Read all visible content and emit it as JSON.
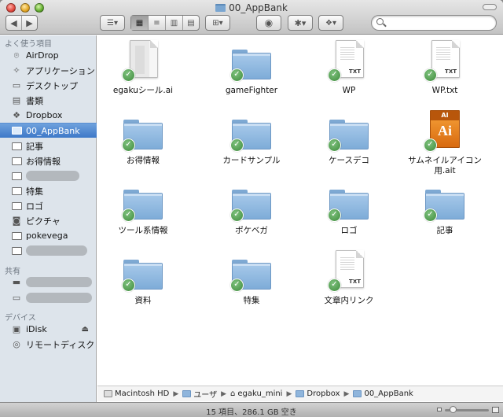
{
  "window": {
    "title": "00_AppBank",
    "search": {
      "placeholder": "",
      "value": ""
    }
  },
  "toolbar": {
    "back_icon": "chevron-left-icon",
    "forward_icon": "chevron-right-icon",
    "view_modes": [
      "icon",
      "list",
      "column",
      "coverflow"
    ],
    "active_view": "icon"
  },
  "sidebar": {
    "favorites_heading": "よく使う項目",
    "favorites": [
      {
        "label": "AirDrop",
        "icon": "airdrop-icon"
      },
      {
        "label": "アプリケーション",
        "icon": "applications-icon"
      },
      {
        "label": "デスクトップ",
        "icon": "desktop-icon"
      },
      {
        "label": "書類",
        "icon": "documents-icon"
      },
      {
        "label": "Dropbox",
        "icon": "dropbox-icon"
      },
      {
        "label": "00_AppBank",
        "icon": "folder-icon",
        "selected": true
      },
      {
        "label": "記事",
        "icon": "folder-icon"
      },
      {
        "label": "お得情報",
        "icon": "folder-icon"
      },
      {
        "label": "",
        "icon": "folder-icon",
        "redacted": true
      },
      {
        "label": "特集",
        "icon": "folder-icon"
      },
      {
        "label": "ロゴ",
        "icon": "folder-icon"
      },
      {
        "label": "ピクチャ",
        "icon": "pictures-icon"
      },
      {
        "label": "pokevega",
        "icon": "folder-icon"
      },
      {
        "label": "",
        "icon": "folder-icon",
        "redacted": true
      }
    ],
    "shared_heading": "共有",
    "shared": [
      {
        "label": "",
        "icon": "server-icon",
        "redacted": true
      },
      {
        "label": "",
        "icon": "computer-icon",
        "redacted": true
      }
    ],
    "devices_heading": "デバイス",
    "devices": [
      {
        "label": "iDisk",
        "icon": "idisk-icon"
      },
      {
        "label": "リモートディスク",
        "icon": "remote-disc-icon"
      }
    ]
  },
  "files": [
    {
      "name": "egakuシール.ai",
      "kind": "doc-gray"
    },
    {
      "name": "gameFighter",
      "kind": "folder"
    },
    {
      "name": "WP",
      "kind": "txt",
      "badge": "TXT"
    },
    {
      "name": "WP.txt",
      "kind": "txt",
      "badge": "TXT"
    },
    {
      "name": "お得情報",
      "kind": "folder"
    },
    {
      "name": "カードサンプル",
      "kind": "folder"
    },
    {
      "name": "ケースデコ",
      "kind": "folder"
    },
    {
      "name": "サムネイルアイコン用.ait",
      "kind": "ai",
      "badge": "AI",
      "big": "Ai"
    },
    {
      "name": "ツール系情報",
      "kind": "folder"
    },
    {
      "name": "ポケベガ",
      "kind": "folder"
    },
    {
      "name": "ロゴ",
      "kind": "folder"
    },
    {
      "name": "記事",
      "kind": "folder"
    },
    {
      "name": "資料",
      "kind": "folder"
    },
    {
      "name": "特集",
      "kind": "folder"
    },
    {
      "name": "文章内リンク",
      "kind": "txt",
      "badge": "TXT"
    }
  ],
  "pathbar": [
    "Macintosh HD",
    "ユーザ",
    "egaku_mini",
    "Dropbox",
    "00_AppBank"
  ],
  "status": {
    "text": "15 項目、286.1 GB 空き"
  }
}
